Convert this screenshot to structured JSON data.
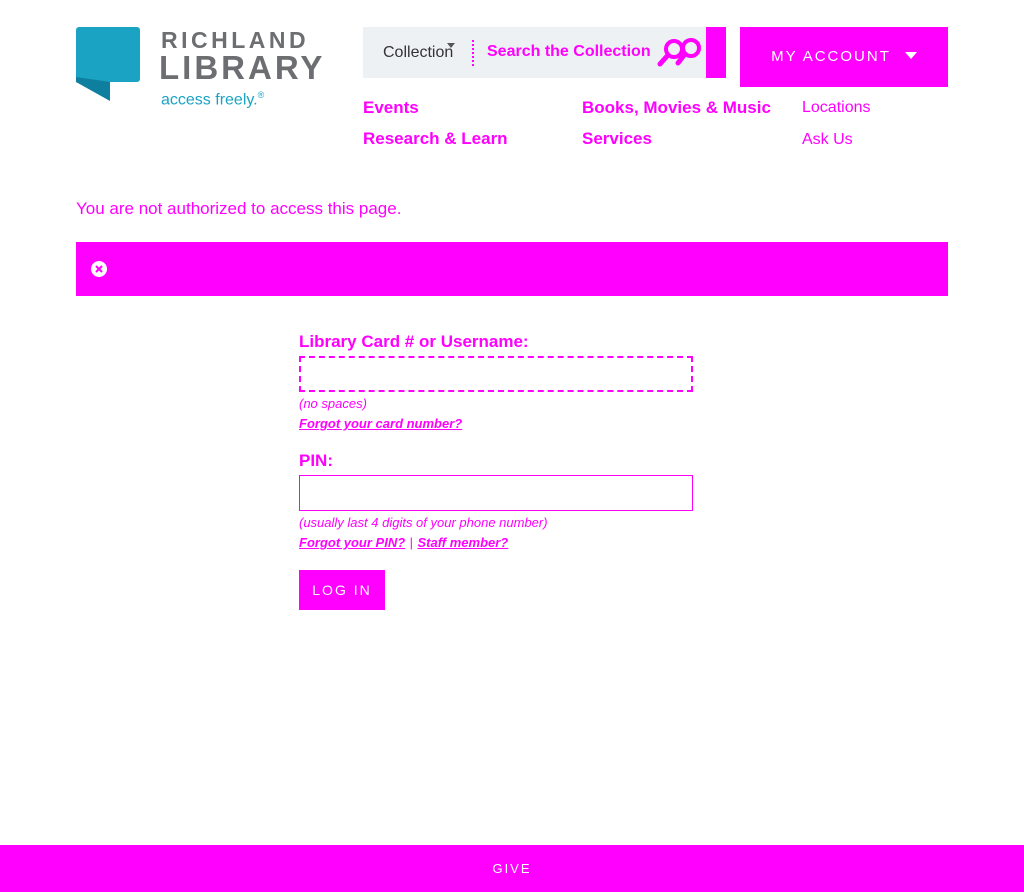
{
  "logo": {
    "line1": "RICHLAND",
    "line2": "LIBRARY",
    "tagline": "access freely.",
    "tagline_mark": "®"
  },
  "search": {
    "scope": "Collection",
    "placeholder": "Search the Collection"
  },
  "account": {
    "label": "MY ACCOUNT"
  },
  "nav": {
    "col1": [
      "Events",
      "Research & Learn"
    ],
    "col2": [
      "Books, Movies & Music",
      "Services"
    ],
    "col3": [
      "Locations",
      "Ask Us"
    ]
  },
  "notice": "You are not authorized to access this page.",
  "form": {
    "username_label": "Library Card # or Username:",
    "username_value": "",
    "username_hint": "(no spaces)",
    "forgot_card": "Forgot your card number?",
    "pin_label": "PIN:",
    "pin_value": "",
    "pin_hint": "(usually last 4 digits of your phone number)",
    "forgot_pin": "Forgot your PIN?",
    "separator": "|",
    "staff": "Staff member?",
    "submit": "LOG IN"
  },
  "footer": {
    "label": "GIVE"
  },
  "colors": {
    "accent": "#ff00ff",
    "logo_blue": "#1aa3c2",
    "logo_gray": "#6d6e71"
  }
}
